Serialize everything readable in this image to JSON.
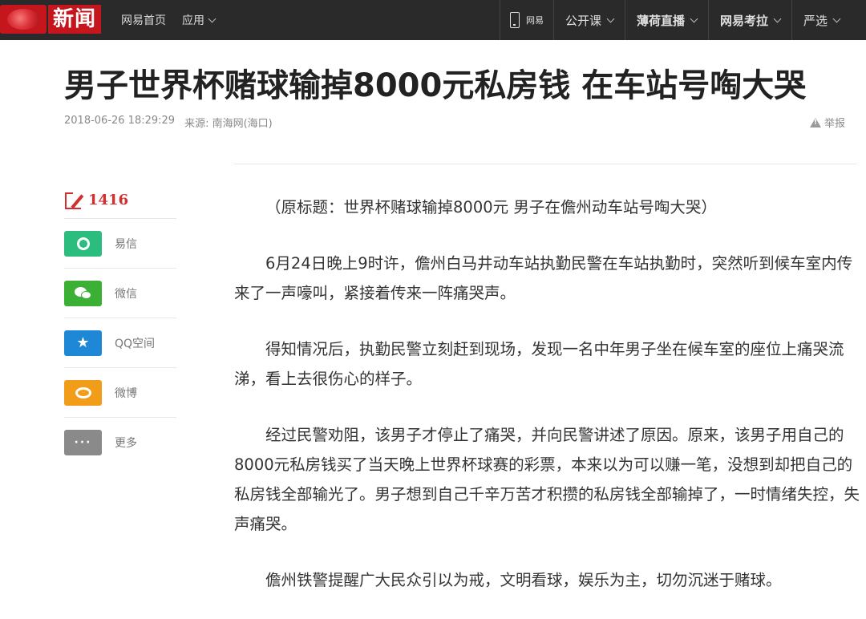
{
  "topbar": {
    "logo_text": "新闻",
    "nav_home": "网易首页",
    "nav_apps": "应用",
    "mobile_label": "网易",
    "open_course": "公开课",
    "live": "薄荷直播",
    "exam": "网易考拉",
    "yanxuan": "严选"
  },
  "article": {
    "title": "男子世界杯赌球输掉8000元私房钱 在车站号啕大哭",
    "datetime": "2018-06-26 18:29:29",
    "source": "来源: 南海网(海口)",
    "report_label": "举报",
    "paragraphs": [
      "（原标题：世界杯赌球输掉8000元 男子在儋州动车站号啕大哭）",
      "6月24日晚上9时许，儋州白马井动车站执勤民警在车站执勤时，突然听到候车室内传来了一声嚎叫，紧接着传来一阵痛哭声。",
      "得知情况后，执勤民警立刻赶到现场，发现一名中年男子坐在候车室的座位上痛哭流涕，看上去很伤心的样子。",
      "经过民警劝阻，该男子才停止了痛哭，并向民警讲述了原因。原来，该男子用自己的8000元私房钱买了当天晚上世界杯球赛的彩票，本来以为可以赚一笔，没想到却把自己的私房钱全部输光了。男子想到自己千辛万苦才积攒的私房钱全部输掉了，一时情绪失控，失声痛哭。",
      "儋州铁警提醒广大民众引以为戒，文明看球，娱乐为主，切勿沉迷于赌球。"
    ]
  },
  "sidebar": {
    "comment_count": "1416",
    "share": [
      {
        "label": "易信",
        "icon": "yixin-icon"
      },
      {
        "label": "微信",
        "icon": "wechat-icon"
      },
      {
        "label": "QQ空间",
        "icon": "qzone-icon"
      },
      {
        "label": "微博",
        "icon": "weibo-icon"
      },
      {
        "label": "更多",
        "icon": "more-icon"
      }
    ]
  },
  "colors": {
    "topbar": "#2a2a2a",
    "brand_red": "#c5161d",
    "comment_red": "#d32f2f"
  }
}
